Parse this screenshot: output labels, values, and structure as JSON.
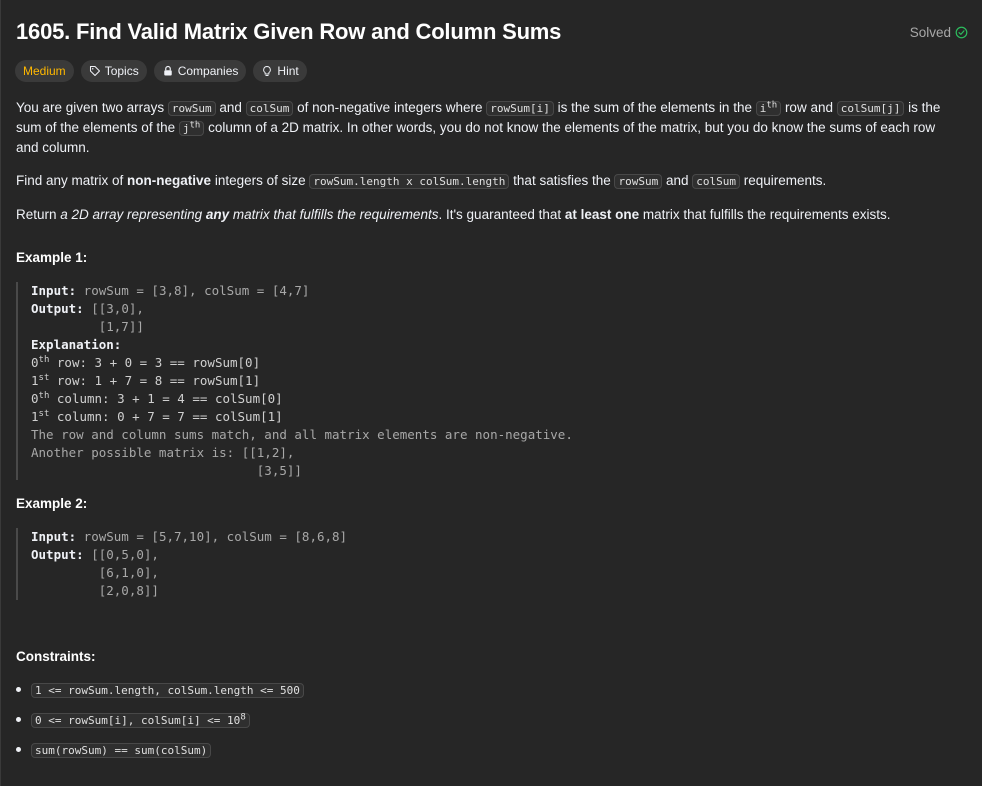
{
  "title": "1605. Find Valid Matrix Given Row and Column Sums",
  "status": "Solved",
  "tags": {
    "difficulty": "Medium",
    "topics": "Topics",
    "companies": "Companies",
    "hint": "Hint"
  },
  "desc": {
    "p1": [
      "You are given two arrays ",
      "rowSum",
      " and ",
      "colSum",
      " of non-negative integers where ",
      "rowSum[i]",
      " is the sum of the elements in the ",
      "i",
      "th",
      " row and ",
      "colSum[j]",
      " is the sum of the elements of the ",
      "j",
      "th",
      " column of a 2D matrix. In other words, you do not know the elements of the matrix, but you do know the sums of each row and column."
    ],
    "p2": [
      "Find any matrix of ",
      "non-negative",
      " integers of size ",
      "rowSum.length x colSum.length",
      " that satisfies the ",
      "rowSum",
      " and ",
      "colSum",
      " requirements."
    ],
    "p3": [
      "Return ",
      "a 2D array representing ",
      "any",
      " matrix that fulfills the requirements",
      ". It's guaranteed that ",
      "at least one",
      " matrix that fulfills the requirements exists."
    ]
  },
  "example1": {
    "title": "Example 1:",
    "input_label": "Input:",
    "input": " rowSum = [3,8], colSum = [4,7]",
    "output_label": "Output:",
    "output1": " [[3,0],",
    "output2": "         [1,7]]",
    "expl_label": "Explanation:",
    "lines": [
      [
        "0",
        "th",
        " row: 3 + 0 = 3 == rowSum[0]"
      ],
      [
        "1",
        "st",
        " row: 1 + 7 = 8 == rowSum[1]"
      ],
      [
        "0",
        "th",
        " column: 3 + 1 = 4 == colSum[0]"
      ],
      [
        "1",
        "st",
        " column: 0 + 7 = 7 == colSum[1]"
      ]
    ],
    "note1": "The row and column sums match, and all matrix elements are non-negative.",
    "note2": "Another possible matrix is: [[1,2],",
    "note3": "                              [3,5]]"
  },
  "example2": {
    "title": "Example 2:",
    "input_label": "Input:",
    "input": " rowSum = [5,7,10], colSum = [8,6,8]",
    "output_label": "Output:",
    "output1": " [[0,5,0],",
    "output2": "         [6,1,0],",
    "output3": "         [2,0,8]]"
  },
  "constraints": {
    "title": "Constraints:",
    "c1": "1 <= rowSum.length, colSum.length <= 500",
    "c2": "0 <= rowSum[i], colSum[i] <= 10",
    "c2_sup": "8",
    "c3": "sum(rowSum) == sum(colSum)"
  },
  "colors": {
    "accent_medium": "#ffb800",
    "solved_check": "#2cbb5d",
    "background": "#262626"
  }
}
